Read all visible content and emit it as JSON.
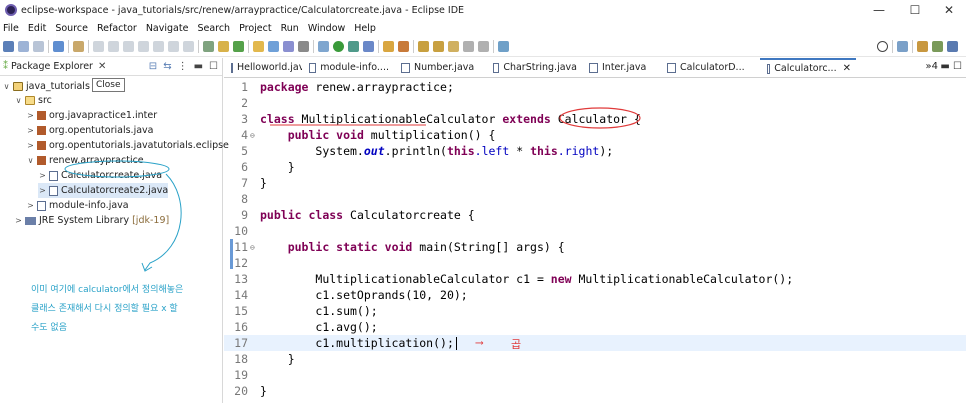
{
  "window": {
    "title": "eclipse-workspace - java_tutorials/src/renew/arraypractice/Calculatorcreate.java - Eclipse IDE",
    "controls": {
      "minimize": "—",
      "maximize": "☐",
      "close": "✕"
    }
  },
  "menubar": [
    "File",
    "Edit",
    "Source",
    "Refactor",
    "Navigate",
    "Search",
    "Project",
    "Run",
    "Window",
    "Help"
  ],
  "package_explorer": {
    "title": "Package Explorer",
    "tooltip": "Close",
    "tree": [
      {
        "label": "java_tutorials",
        "arrow": "∨",
        "icon": "project-icon"
      },
      {
        "label": "src",
        "arrow": "∨",
        "icon": "source-folder-icon"
      },
      {
        "label": "org.javapractice1.inter",
        "arrow": ">",
        "icon": "package-icon"
      },
      {
        "label": "org.opentutorials.java",
        "arrow": ">",
        "icon": "package-icon"
      },
      {
        "label": "org.opentutorials.javatutorials.eclipse",
        "arrow": ">",
        "icon": "package-icon"
      },
      {
        "label": "renew.arraypractice",
        "arrow": "∨",
        "icon": "package-icon"
      },
      {
        "label": "Calculatorcreate.java",
        "arrow": ">",
        "icon": "java-file-icon"
      },
      {
        "label": "Calculatorcreate2.java",
        "arrow": ">",
        "icon": "java-file-icon"
      },
      {
        "label": "module-info.java",
        "arrow": ">",
        "icon": "java-file-icon"
      },
      {
        "label": "JRE System Library",
        "suffix": "[jdk-19]",
        "arrow": ">",
        "icon": "library-icon"
      }
    ],
    "annotation": [
      "이미 여기에 calculator에서 정의해놓은",
      "클래스 존재해서 다시 정의할 필요 x 할",
      "수도 없음"
    ]
  },
  "editor": {
    "tabs": [
      {
        "label": "Helloworld.java",
        "active": false
      },
      {
        "label": "module-info....",
        "active": false
      },
      {
        "label": "Number.java",
        "active": false
      },
      {
        "label": "CharString.java",
        "active": false
      },
      {
        "label": "Inter.java",
        "active": false
      },
      {
        "label": "CalculatorD...",
        "active": false
      },
      {
        "label": "Calculatorc...",
        "active": true
      }
    ],
    "overflow": "»4",
    "line_numbers": [
      "1",
      "2",
      "3",
      "4",
      "5",
      "6",
      "7",
      "8",
      "9",
      "10",
      "11",
      "12",
      "13",
      "14",
      "15",
      "16",
      "17",
      "18",
      "19",
      "20"
    ],
    "code": {
      "l1_kw": "package",
      "l1_rest": " renew.arraypractice;",
      "l3_kw1": "class",
      "l3_a": " MultiplicationableCalculator ",
      "l3_kw2": "extends",
      "l3_b": " Calculator {",
      "l4_kw1": "public",
      "l4_kw2": " void",
      "l4_rest": " multiplication() {",
      "l5_a": "System.",
      "l5_out": "out",
      "l5_b": ".println(",
      "l5_this1": "this",
      "l5_left": ".left",
      "l5_mid": " * ",
      "l5_this2": "this",
      "l5_right": ".right",
      "l5_end": ");",
      "l6": "}",
      "l7": "}",
      "l9_kw1": "public",
      "l9_kw2": " class",
      "l9_rest": " Calculatorcreate {",
      "l11_kw1": "public",
      "l11_kw2": " static",
      "l11_kw3": " void",
      "l11_rest": " main(String[] args) {",
      "l13_a": "MultiplicationableCalculator c1 = ",
      "l13_kw": "new",
      "l13_b": " MultiplicationableCalculator();",
      "l14": "c1.setOprands(10, 20);",
      "l15": "c1.sum();",
      "l16": "c1.avg();",
      "l17": "c1.multiplication();",
      "l18": "}",
      "l20": "}"
    },
    "handwritten": {
      "arrow": "⟶",
      "note": "곱"
    }
  }
}
